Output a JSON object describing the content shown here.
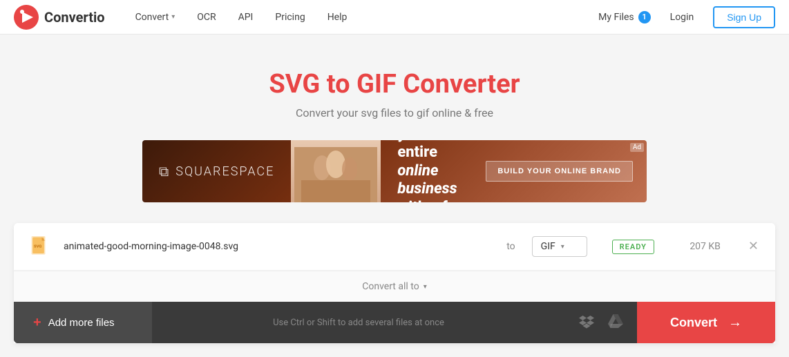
{
  "header": {
    "logo_text": "Convertio",
    "nav_items": [
      {
        "label": "Convert",
        "has_dropdown": true
      },
      {
        "label": "OCR",
        "has_dropdown": false
      },
      {
        "label": "API",
        "has_dropdown": false
      },
      {
        "label": "Pricing",
        "has_dropdown": false
      },
      {
        "label": "Help",
        "has_dropdown": false
      }
    ],
    "my_files_label": "My Files",
    "my_files_count": "1",
    "login_label": "Login",
    "signup_label": "Sign Up"
  },
  "hero": {
    "title": "SVG to GIF Converter",
    "subtitle": "Convert your svg files to gif online & free"
  },
  "ad": {
    "brand": "SQUARESPACE",
    "headline_line1": "Brand your entire",
    "headline_line2": "online business",
    "headline_line3": "with a few clicks.",
    "cta": "BUILD YOUR ONLINE BRAND",
    "badge": "Ad"
  },
  "file_row": {
    "file_name": "animated-good-morning-image-0048.svg",
    "to_label": "to",
    "format": "GIF",
    "status": "READY",
    "file_size": "207 KB"
  },
  "convert_all": {
    "label": "Convert all to"
  },
  "bottom_bar": {
    "add_files_label": "Add more files",
    "drag_hint": "Use Ctrl or Shift to add several files at once",
    "convert_label": "Convert"
  }
}
